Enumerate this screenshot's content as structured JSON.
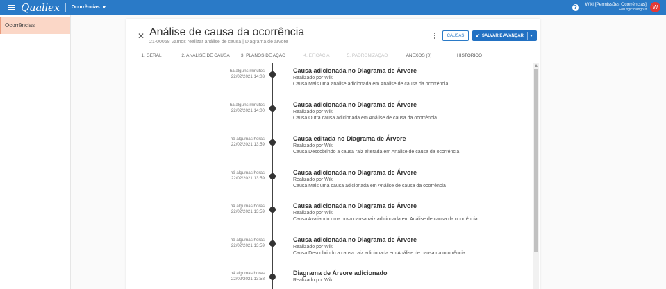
{
  "topbar": {
    "logo": "Qualiex",
    "module": "Ocorrências",
    "help_symbol": "?",
    "user_name": "Wiki [Permissões Ocorrências]",
    "user_org": "ForLogic Hangout",
    "avatar_letter": "W",
    "bar_color": "#2a7ac7"
  },
  "sidebar": {
    "items": [
      {
        "label": "Ocorrências"
      }
    ]
  },
  "header": {
    "title": "Análise de causa da ocorrência",
    "subtitle": "21-00058 Vamos realizar análise de causa | Diagrama de árvore",
    "causas_label": "CAUSAS",
    "save_label": "SALVAR E AVANÇAR"
  },
  "tabs": [
    {
      "label": "1. GERAL"
    },
    {
      "label": "2. ANÁLISE DE CAUSA"
    },
    {
      "label": "3. PLANOS DE AÇÃO"
    },
    {
      "label": "4. EFICÁCIA"
    },
    {
      "label": "5. PADRONIZAÇÃO"
    },
    {
      "label": "ANEXOS (0)"
    },
    {
      "label": "HISTÓRICO"
    }
  ],
  "history": [
    {
      "relative": "há alguns minutos",
      "datetime": "22/02/2021 14:03",
      "title": "Causa adicionada no Diagrama de Árvore",
      "by": "Realizado por Wiki",
      "desc": "Causa Mais uma análise adicionada em Análise de causa da ocorrência"
    },
    {
      "relative": "há alguns minutos",
      "datetime": "22/02/2021 14:00",
      "title": "Causa adicionada no Diagrama de Árvore",
      "by": "Realizado por Wiki",
      "desc": "Causa Outra causa adicionada em Análise de causa da ocorrência"
    },
    {
      "relative": "há algumas horas",
      "datetime": "22/02/2021 13:59",
      "title": "Causa editada no Diagrama de Árvore",
      "by": "Realizado por Wiki",
      "desc": "Causa Descobrindo a causa raiz alterada em Análise de causa da ocorrência"
    },
    {
      "relative": "há algumas horas",
      "datetime": "22/02/2021 13:59",
      "title": "Causa adicionada no Diagrama de Árvore",
      "by": "Realizado por Wiki",
      "desc": "Causa Mais uma causa adicionada em Análise de causa da ocorrência"
    },
    {
      "relative": "há algumas horas",
      "datetime": "22/02/2021 13:59",
      "title": "Causa adicionada no Diagrama de Árvore",
      "by": "Realizado por Wiki",
      "desc": "Causa Avaliando uma nova causa raiz adicionada em Análise de causa da ocorrência"
    },
    {
      "relative": "há algumas horas",
      "datetime": "22/02/2021 13:59",
      "title": "Causa adicionada no Diagrama de Árvore",
      "by": "Realizado por Wiki",
      "desc": "Causa Descobrindo a causa raiz adicionada em Análise de causa da ocorrência"
    },
    {
      "relative": "há algumas horas",
      "datetime": "22/02/2021 13:58",
      "title": "Diagrama de Árvore adicionado",
      "by": "Realizado por Wiki",
      "desc": ""
    }
  ]
}
